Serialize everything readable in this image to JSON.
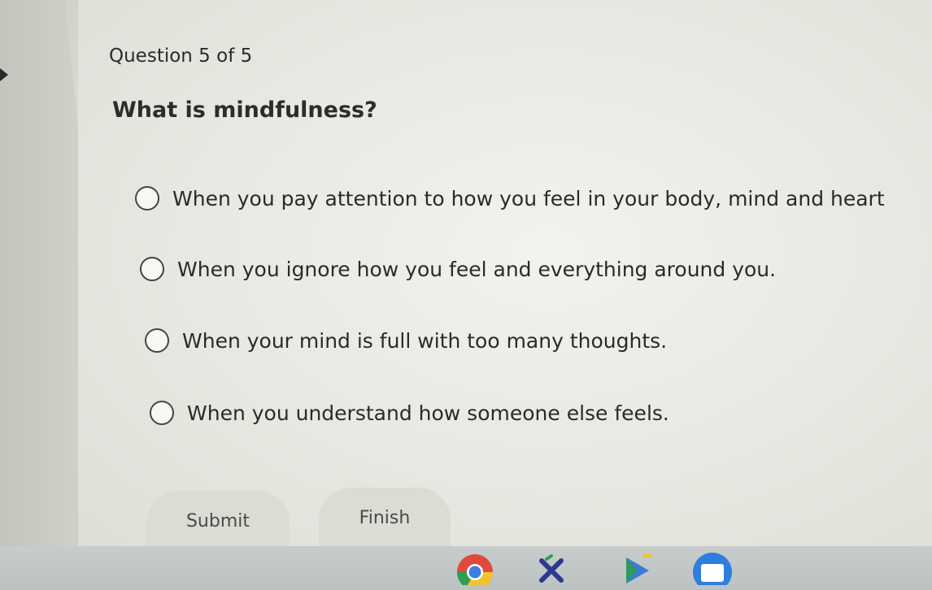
{
  "quiz": {
    "counter": "Question 5 of 5",
    "question": "What is mindfulness?",
    "options": [
      {
        "label": "When you pay attention to how you feel in your body, mind and heart"
      },
      {
        "label": "When you ignore how you feel and everything around you."
      },
      {
        "label": "When your mind is full with too many thoughts."
      },
      {
        "label": "When you understand how someone else feels."
      }
    ],
    "submit_label": "Submit",
    "finish_label": "Finish"
  },
  "shelf": {
    "apps": [
      "chrome-icon",
      "math-app-icon",
      "play-store-icon",
      "files-app-icon"
    ],
    "colors": {
      "chrome_red": "#e04a3a",
      "chrome_yellow": "#f2c230",
      "chrome_green": "#2f9e52",
      "chrome_blue": "#3b7de0",
      "files_blue": "#2f7ddc",
      "play_blue": "#3a7bd5"
    }
  }
}
